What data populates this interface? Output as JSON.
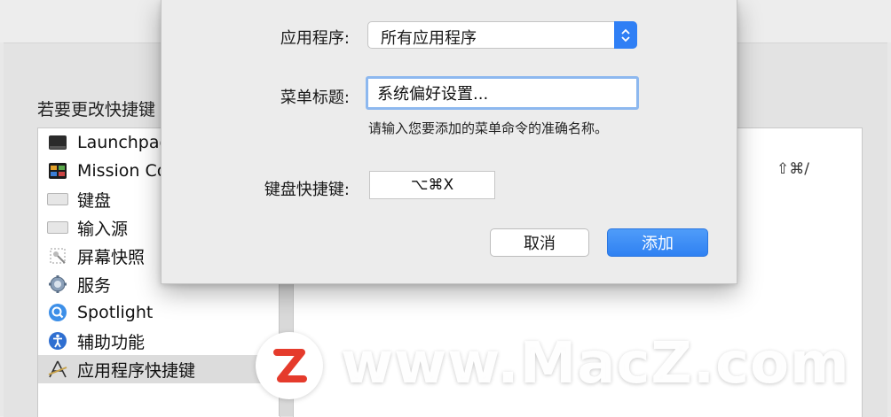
{
  "background": {
    "hint_text": "若要更改快捷键",
    "categories": [
      {
        "label": "Launchpad",
        "icon": "launchpad-icon"
      },
      {
        "label": "Mission Control",
        "icon": "mission-control-icon"
      },
      {
        "label": "键盘",
        "icon": "keyboard-icon"
      },
      {
        "label": "输入源",
        "icon": "input-sources-icon"
      },
      {
        "label": "屏幕快照",
        "icon": "screenshot-icon"
      },
      {
        "label": "服务",
        "icon": "gear-icon"
      },
      {
        "label": "Spotlight",
        "icon": "spotlight-icon"
      },
      {
        "label": "辅助功能",
        "icon": "accessibility-icon"
      },
      {
        "label": "应用程序快捷键",
        "icon": "app-shortcuts-icon"
      }
    ],
    "selected_index": 8,
    "pane_shortcut": "⇧⌘/"
  },
  "dialog": {
    "app_label": "应用程序:",
    "app_value": "所有应用程序",
    "menu_title_label": "菜单标题:",
    "menu_title_value": "系统偏好设置...",
    "helper_text": "请输入您要添加的菜单命令的准确名称。",
    "shortcut_label": "键盘快捷键:",
    "shortcut_value": "⌥⌘X",
    "cancel_label": "取消",
    "add_label": "添加"
  },
  "watermark": {
    "text": "www.MacZ.com",
    "badge_letter": "Z"
  },
  "colors": {
    "accent": "#2f81f2",
    "focus_ring": "#8db8ef",
    "watermark_red": "#e53b2c"
  }
}
